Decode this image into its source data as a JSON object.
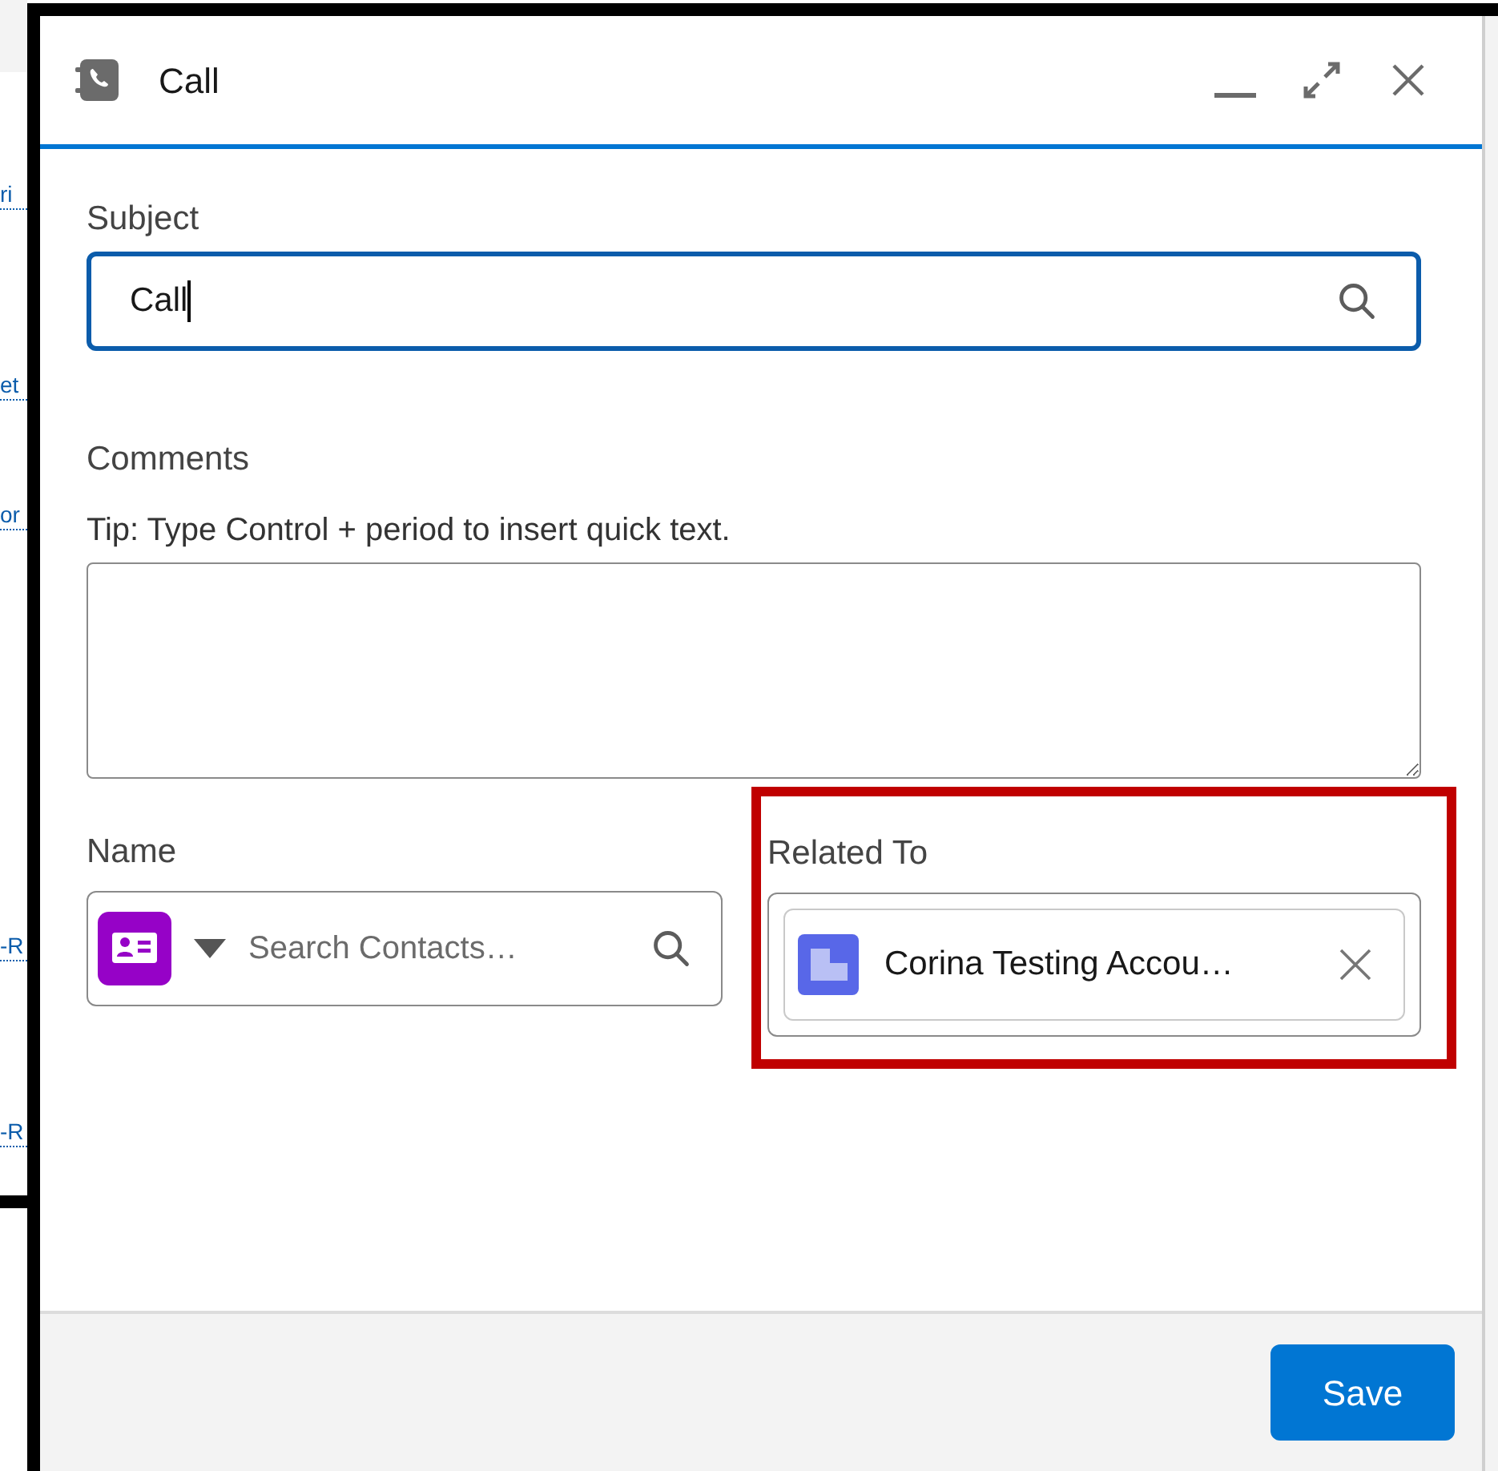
{
  "background_fragments": [
    "ri",
    "et",
    "or",
    "-R",
    "-R"
  ],
  "dialog": {
    "title": "Call"
  },
  "form": {
    "subject": {
      "label": "Subject",
      "value": "Call",
      "focused": true
    },
    "comments": {
      "label": "Comments",
      "tip": "Tip: Type Control + period to insert quick text."
    },
    "name": {
      "label": "Name",
      "placeholder": "Search Contacts…"
    },
    "related_to": {
      "label": "Related To",
      "value": "Corina Testing Accou…",
      "highlighted": true
    }
  },
  "footer": {
    "buttons": [
      "Save"
    ]
  }
}
